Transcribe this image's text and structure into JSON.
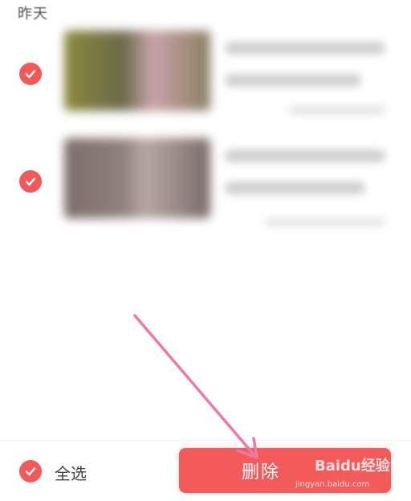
{
  "list": {
    "section_title": "昨天",
    "items": [
      {
        "checked": true,
        "thumbnail": "video-thumbnail-1"
      },
      {
        "checked": true,
        "thumbnail": "video-thumbnail-2"
      }
    ]
  },
  "footer": {
    "select_all_label": "全选",
    "select_all_checked": true,
    "delete_label": "删除"
  },
  "watermark": {
    "brand": "Baidu经验",
    "url": "jingyan.baidu.com"
  },
  "colors": {
    "accent": "#f25a5a",
    "annotation_arrow": "#ee78a8"
  },
  "icons": {
    "check": "check-icon"
  }
}
